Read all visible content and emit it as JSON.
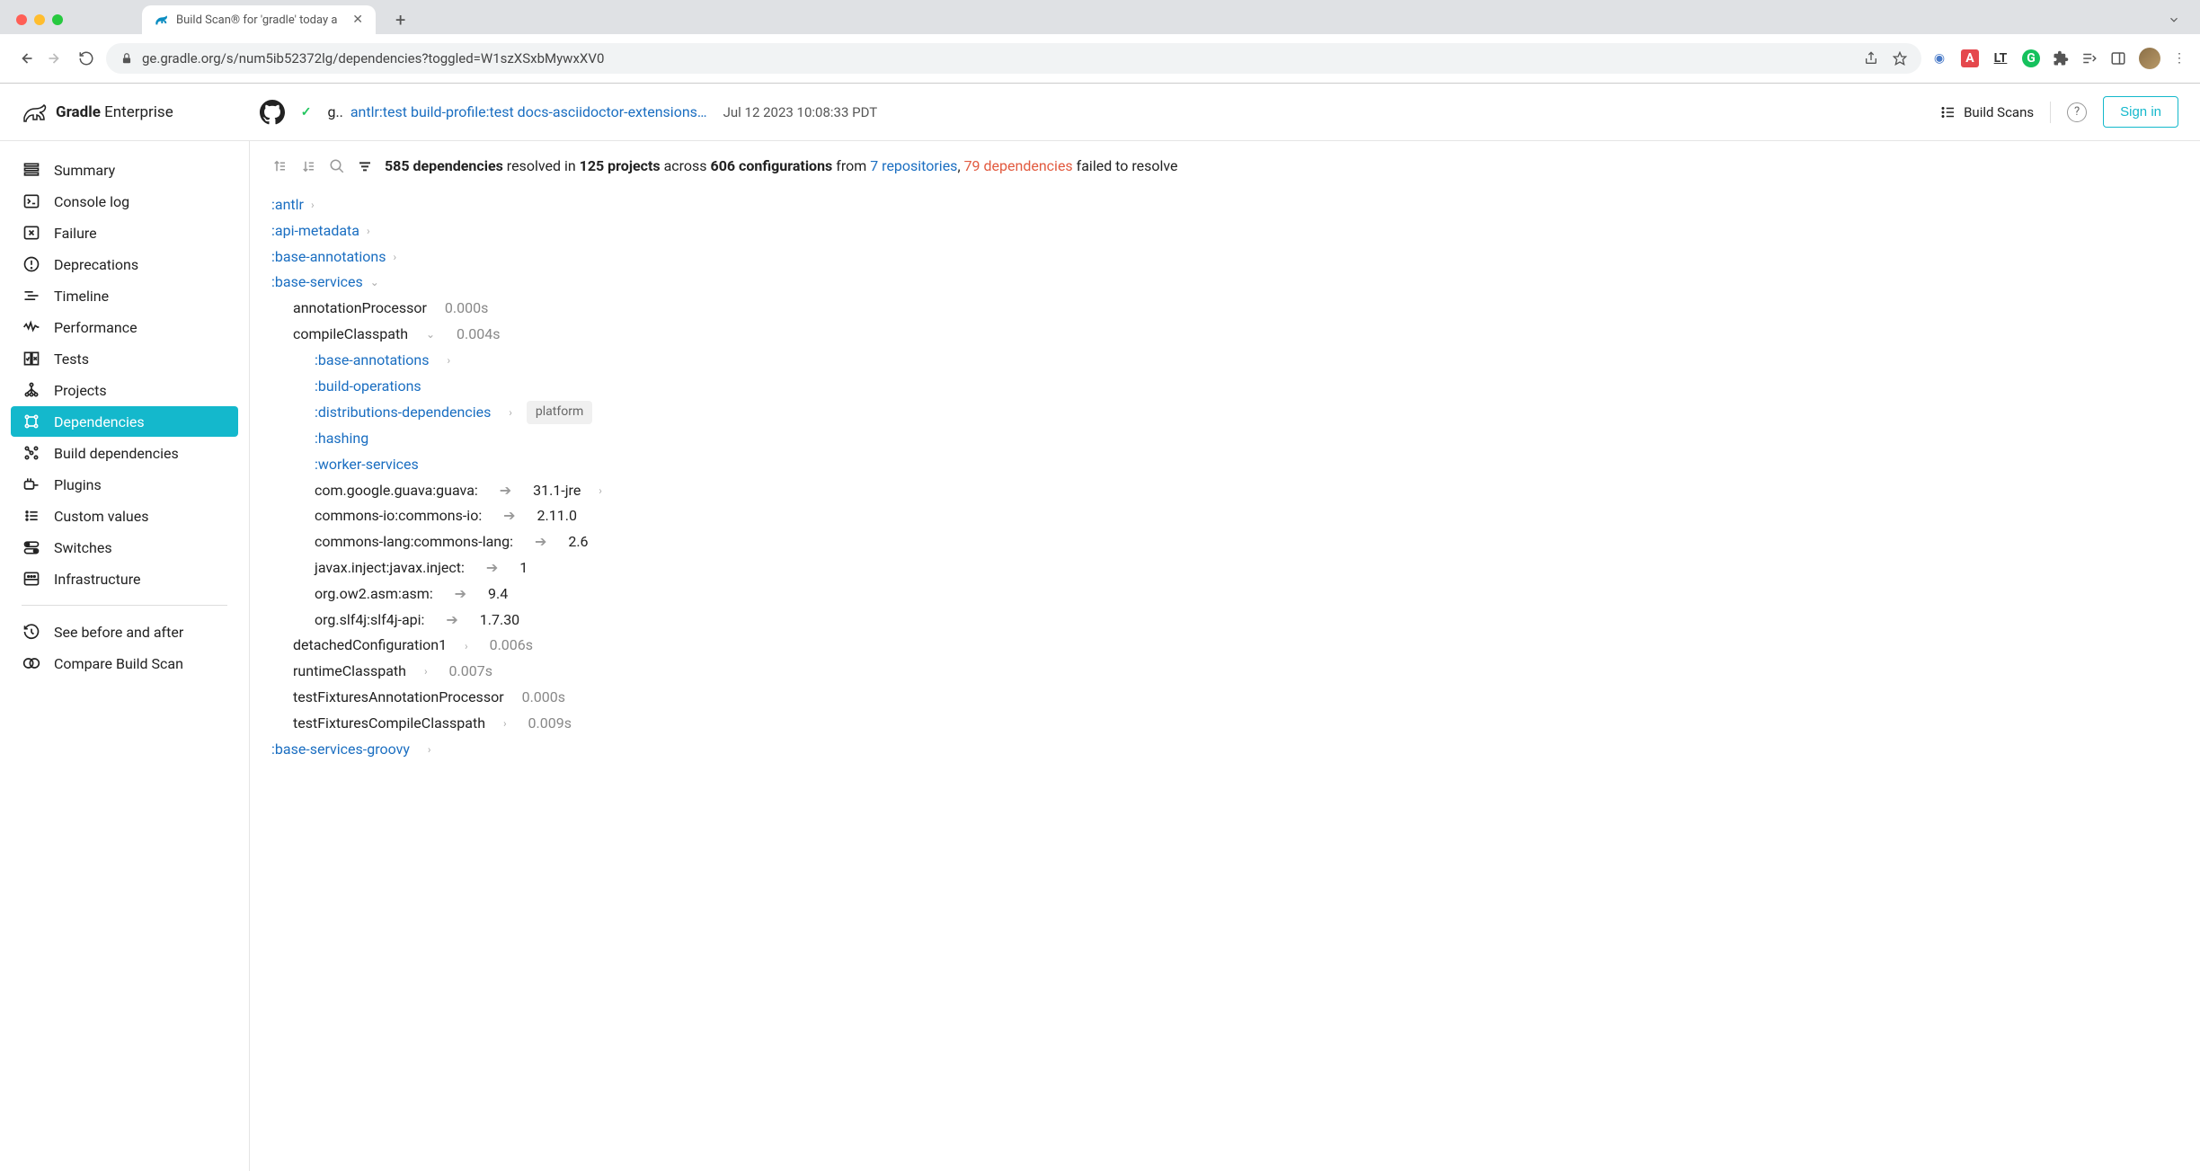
{
  "browser": {
    "tab_title": "Build Scan® for 'gradle' today a",
    "url": "ge.gradle.org/s/num5ib52372lg/dependencies?toggled=W1szXSxbMywxXV0"
  },
  "header": {
    "logo_main": "Gradle",
    "logo_sub": "Enterprise",
    "build_prefix": "g..",
    "build_title": "antlr:test build-profile:test docs-asciidoctor-extensions…",
    "timestamp": "Jul 12 2023 10:08:33 PDT",
    "build_scans": "Build Scans",
    "signin": "Sign in"
  },
  "sidebar": {
    "items": [
      {
        "id": "summary",
        "label": "Summary"
      },
      {
        "id": "console-log",
        "label": "Console log"
      },
      {
        "id": "failure",
        "label": "Failure"
      },
      {
        "id": "deprecations",
        "label": "Deprecations"
      },
      {
        "id": "timeline",
        "label": "Timeline"
      },
      {
        "id": "performance",
        "label": "Performance"
      },
      {
        "id": "tests",
        "label": "Tests"
      },
      {
        "id": "projects",
        "label": "Projects"
      },
      {
        "id": "dependencies",
        "label": "Dependencies"
      },
      {
        "id": "build-dependencies",
        "label": "Build dependencies"
      },
      {
        "id": "plugins",
        "label": "Plugins"
      },
      {
        "id": "custom-values",
        "label": "Custom values"
      },
      {
        "id": "switches",
        "label": "Switches"
      },
      {
        "id": "infrastructure",
        "label": "Infrastructure"
      }
    ],
    "footer": {
      "before_after": "See before and after",
      "compare": "Compare Build Scan"
    }
  },
  "summary": {
    "deps_count": "585 dependencies",
    "resolved_in": "resolved in",
    "projects": "125 projects",
    "across": "across",
    "configs": "606 configurations",
    "from": "from",
    "repos": "7 repositories",
    "comma": ", ",
    "failed": "79 dependencies",
    "failed_text": "failed to resolve"
  },
  "tree": {
    "antlr": ":antlr",
    "api_metadata": ":api-metadata",
    "base_annotations": ":base-annotations",
    "base_services": ":base-services",
    "bs": {
      "annotationProcessor": {
        "label": "annotationProcessor",
        "time": "0.000s"
      },
      "compileClasspath": {
        "label": "compileClasspath",
        "time": "0.004s"
      },
      "cc": {
        "base_annotations": ":base-annotations",
        "build_operations": ":build-operations",
        "distributions_dependencies": ":distributions-dependencies",
        "platform_badge": "platform",
        "hashing": ":hashing",
        "worker_services": ":worker-services",
        "guava": {
          "name": "com.google.guava:guava:",
          "version": "31.1-jre"
        },
        "commons_io": {
          "name": "commons-io:commons-io:",
          "version": "2.11.0"
        },
        "commons_lang": {
          "name": "commons-lang:commons-lang:",
          "version": "2.6"
        },
        "javax_inject": {
          "name": "javax.inject:javax.inject:",
          "version": "1"
        },
        "asm": {
          "name": "org.ow2.asm:asm:",
          "version": "9.4"
        },
        "slf4j": {
          "name": "org.slf4j:slf4j-api:",
          "version": "1.7.30"
        }
      },
      "detached": {
        "label": "detachedConfiguration1",
        "time": "0.006s"
      },
      "runtime": {
        "label": "runtimeClasspath",
        "time": "0.007s"
      },
      "tfap": {
        "label": "testFixturesAnnotationProcessor",
        "time": "0.000s"
      },
      "tfcc": {
        "label": "testFixturesCompileClasspath",
        "time": "0.009s"
      }
    },
    "base_services_groovy": ":base-services-groovy"
  }
}
